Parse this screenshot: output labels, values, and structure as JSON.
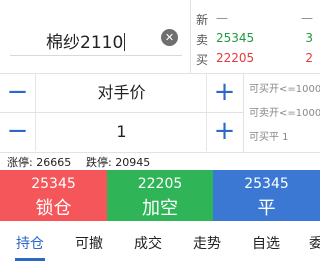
{
  "contract": {
    "value": "棉纱2110",
    "clear_icon": "✕"
  },
  "quote": {
    "latest": {
      "label": "新",
      "price": "—",
      "volume": "—"
    },
    "ask": {
      "label": "卖",
      "price": "25345",
      "volume": "3"
    },
    "bid": {
      "label": "买",
      "price": "22205",
      "volume": "2"
    }
  },
  "price_stepper": {
    "minus": "−",
    "value": "对手价",
    "plus": "+"
  },
  "qty_stepper": {
    "minus": "−",
    "value": "1",
    "plus": "+"
  },
  "available": {
    "open_buy": "可买开<=1000",
    "open_sell": "可卖开<=1000",
    "close_sell": "可买平 1"
  },
  "limits": {
    "up": "涨停: 26665",
    "down": "跌停: 20945"
  },
  "actions": {
    "lock": {
      "price": "25345",
      "label": "锁仓"
    },
    "short": {
      "price": "22205",
      "label": "加空"
    },
    "close": {
      "price": "25345",
      "label": "平"
    }
  },
  "tabs": [
    "持仓",
    "可撤",
    "成交",
    "走势",
    "自选",
    "委"
  ],
  "colors": {
    "red": "#f55659",
    "green": "#2fb558",
    "blue": "#3a78d4",
    "accent": "#2c69c7"
  }
}
